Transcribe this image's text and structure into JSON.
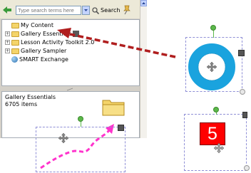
{
  "gallery": {
    "search": {
      "placeholder": "Type search terms here"
    },
    "search_button_label": "Search",
    "tree_items": [
      {
        "label": "My Content",
        "icon": "folder-star-icon",
        "expander": ""
      },
      {
        "label": "Gallery Essentials",
        "icon": "folder-icon",
        "expander": "+"
      },
      {
        "label": "Lesson Activity Toolkit 2.0",
        "icon": "folder-icon",
        "expander": "+"
      },
      {
        "label": "Gallery Sampler",
        "icon": "folder-icon",
        "expander": "+"
      },
      {
        "label": "SMART Exchange",
        "icon": "globe-icon",
        "expander": ""
      }
    ],
    "info": {
      "name": "Gallery Essentials",
      "count": "6705 items"
    }
  },
  "canvas": {
    "number_tile": {
      "value": "5",
      "color": "#ff0000"
    },
    "ring_color": "#1aa3de",
    "path_color": "#ff33cc",
    "arrow_color": "#b01e1e"
  }
}
